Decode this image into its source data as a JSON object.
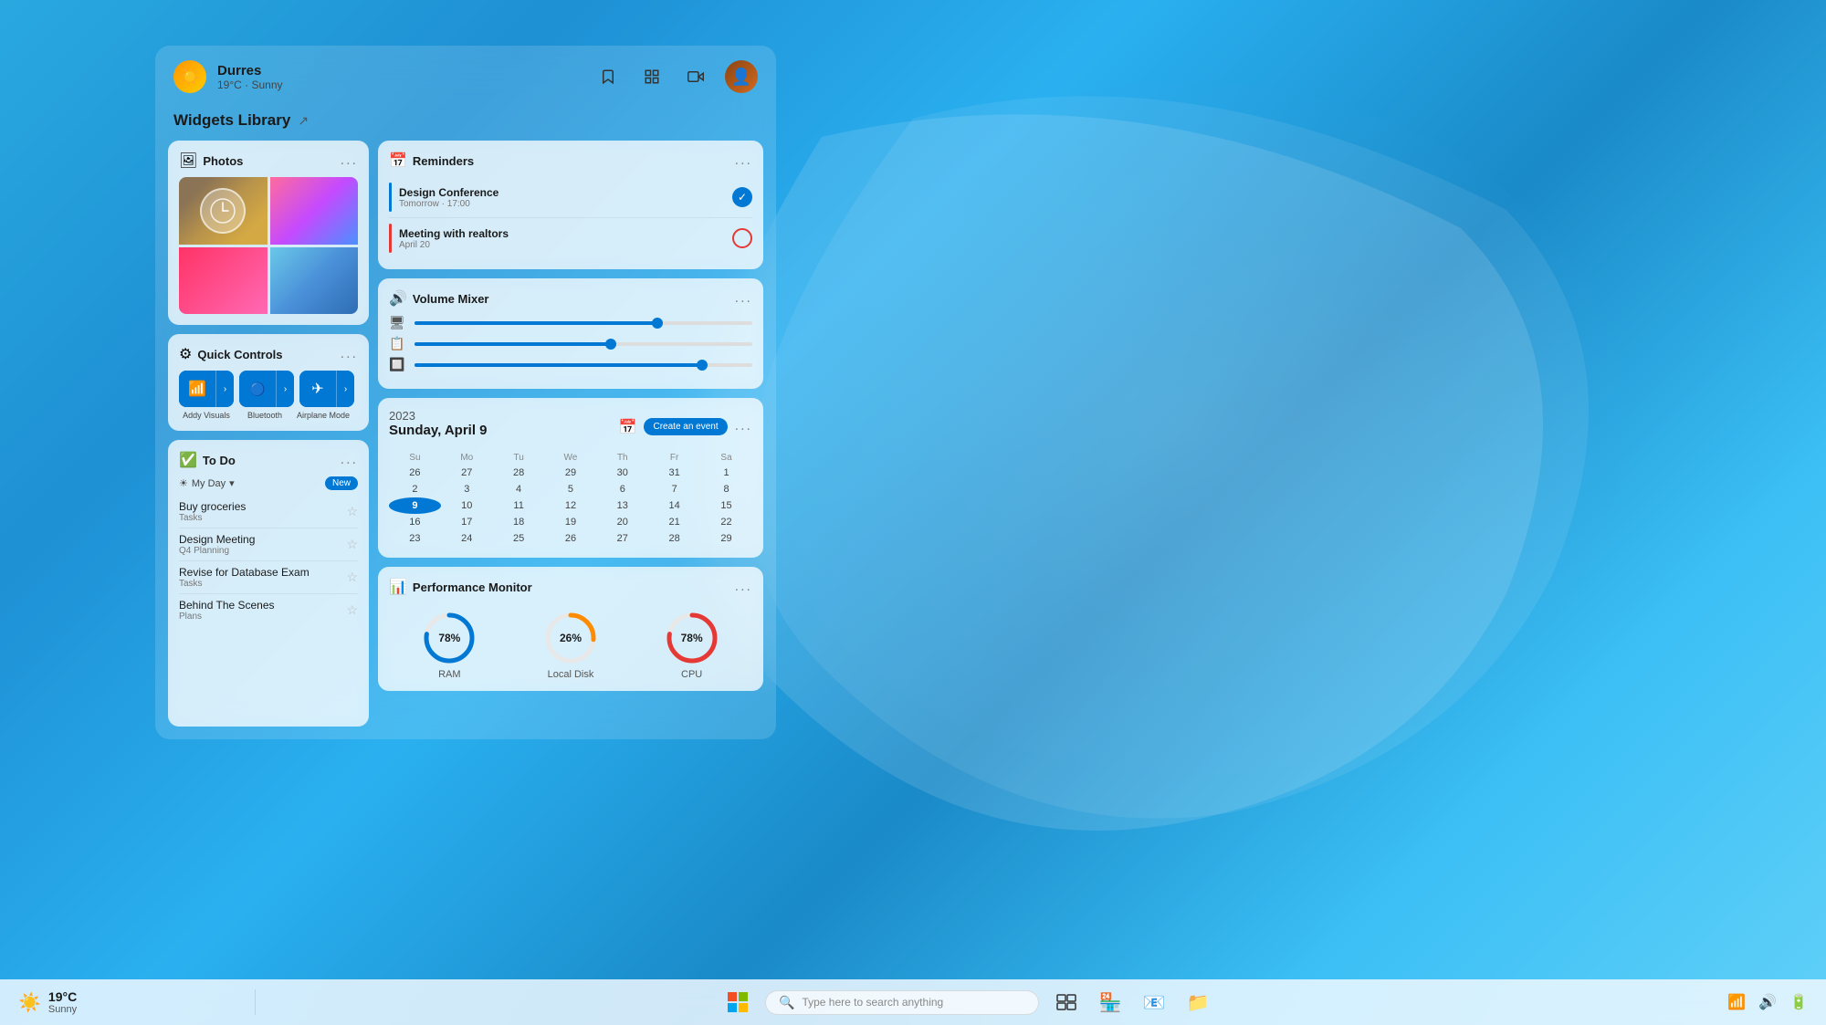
{
  "desktop": {
    "background": "blue-wave"
  },
  "panel_header": {
    "city": "Durres",
    "temperature": "19°C",
    "condition": "Sunny",
    "avatar_emoji": "👤"
  },
  "widgets_library": {
    "title": "Widgets Library",
    "expand_icon": "↗"
  },
  "photos_widget": {
    "title": "Photos",
    "menu": "..."
  },
  "quick_controls_widget": {
    "title": "Quick Controls",
    "menu": "...",
    "buttons": [
      {
        "icon": "📶",
        "label": "Addy Visuals"
      },
      {
        "icon": "🔵",
        "label": "Bluetooth"
      },
      {
        "icon": "✈",
        "label": "Airplane Mode"
      }
    ]
  },
  "todo_widget": {
    "title": "To Do",
    "menu": "...",
    "my_day": "My Day",
    "new_label": "New",
    "items": [
      {
        "title": "Buy groceries",
        "sub": "Tasks"
      },
      {
        "title": "Design Meeting",
        "sub": "Q4 Planning"
      },
      {
        "title": "Revise for Database Exam",
        "sub": "Tasks"
      },
      {
        "title": "Behind The Scenes",
        "sub": "Plans"
      }
    ]
  },
  "reminders_widget": {
    "title": "Reminders",
    "menu": "...",
    "items": [
      {
        "title": "Design Conference",
        "sub": "Tomorrow · 17:00",
        "status": "done"
      },
      {
        "title": "Meeting with realtors",
        "sub": "April 20",
        "status": "open"
      }
    ]
  },
  "volume_widget": {
    "title": "Volume Mixer",
    "menu": "...",
    "sliders": [
      {
        "percent": 72
      },
      {
        "percent": 58
      },
      {
        "percent": 85
      }
    ]
  },
  "calendar_widget": {
    "title": "Calendar",
    "menu": "...",
    "year": "2023",
    "day_label": "Sunday, April 9",
    "create_event_label": "Create an event",
    "days_of_week": [
      "Su",
      "Mo",
      "Tu",
      "We",
      "Th",
      "Fr",
      "Sa"
    ],
    "weeks": [
      [
        "26",
        "27",
        "28",
        "29",
        "30",
        "31",
        "1"
      ],
      [
        "2",
        "3",
        "4",
        "5",
        "6",
        "7",
        "8"
      ],
      [
        "9",
        "10",
        "11",
        "12",
        "13",
        "14",
        "15"
      ],
      [
        "16",
        "17",
        "18",
        "19",
        "20",
        "21",
        "22"
      ],
      [
        "23",
        "24",
        "25",
        "26",
        "27",
        "28",
        "29"
      ]
    ],
    "today": "9",
    "other_month_cells": [
      "26",
      "27",
      "28",
      "29",
      "30",
      "31",
      "26",
      "27",
      "28",
      "29"
    ]
  },
  "performance_widget": {
    "title": "Performance Monitor",
    "menu": "...",
    "gauges": [
      {
        "label": "RAM",
        "value": 78,
        "color": "blue",
        "text": "78%"
      },
      {
        "label": "Local Disk",
        "value": 26,
        "color": "orange",
        "text": "26%"
      },
      {
        "label": "CPU",
        "value": 78,
        "color": "red",
        "text": "78%"
      }
    ]
  },
  "taskbar": {
    "temperature": "19°C",
    "condition": "Sunny",
    "search_placeholder": "Type here to search anything",
    "apps": [
      "🗂",
      "🏪",
      "📧",
      "📁"
    ]
  }
}
